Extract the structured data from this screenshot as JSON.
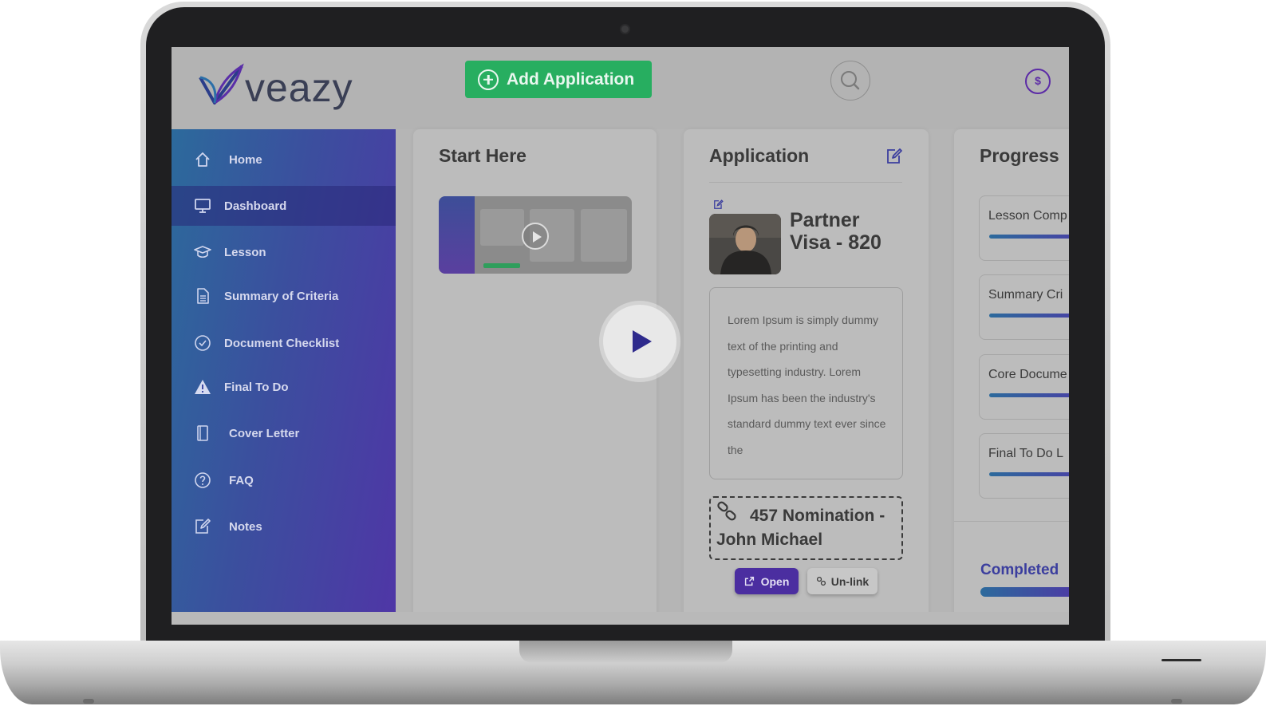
{
  "brand": {
    "name": "veazy"
  },
  "header": {
    "add_button_label": "Add Application",
    "currency_symbol": "$"
  },
  "sidebar": {
    "items": [
      {
        "label": "Home",
        "icon": "home-icon",
        "active": false
      },
      {
        "label": "Dashboard",
        "icon": "monitor-icon",
        "active": true
      },
      {
        "label": "Lesson",
        "icon": "graduation-cap-icon",
        "active": false
      },
      {
        "label": "Summary of Criteria",
        "icon": "document-icon",
        "active": false
      },
      {
        "label": "Document Checklist",
        "icon": "check-circle-icon",
        "active": false
      },
      {
        "label": "Final To Do",
        "icon": "warning-icon",
        "active": false
      },
      {
        "label": "Cover Letter",
        "icon": "notebook-icon",
        "active": false
      },
      {
        "label": "FAQ",
        "icon": "question-circle-icon",
        "active": false
      },
      {
        "label": "Notes",
        "icon": "edit-icon",
        "active": false
      }
    ]
  },
  "start_card": {
    "title": "Start Here"
  },
  "application_card": {
    "title": "Application",
    "visa_name": "Partner Visa - 820",
    "description": "Lorem Ipsum is simply dummy text of the printing and typesetting industry. Lorem Ipsum has been the industry's standard dummy text ever since the",
    "linked_nomination": "457 Nomination - John Michael",
    "open_label": "Open",
    "unlink_label": "Un-link"
  },
  "progress_card": {
    "title": "Progress",
    "items": [
      {
        "label": "Lesson Comp"
      },
      {
        "label": "Summary Cri"
      },
      {
        "label": "Core Docume"
      },
      {
        "label": "Final To Do L"
      }
    ],
    "completed_label": "Completed"
  },
  "colors": {
    "accent_green": "#27ae60",
    "accent_purple": "#4b2ea0",
    "sidebar_start": "#2c6a9c",
    "sidebar_end": "#4f36a6"
  }
}
